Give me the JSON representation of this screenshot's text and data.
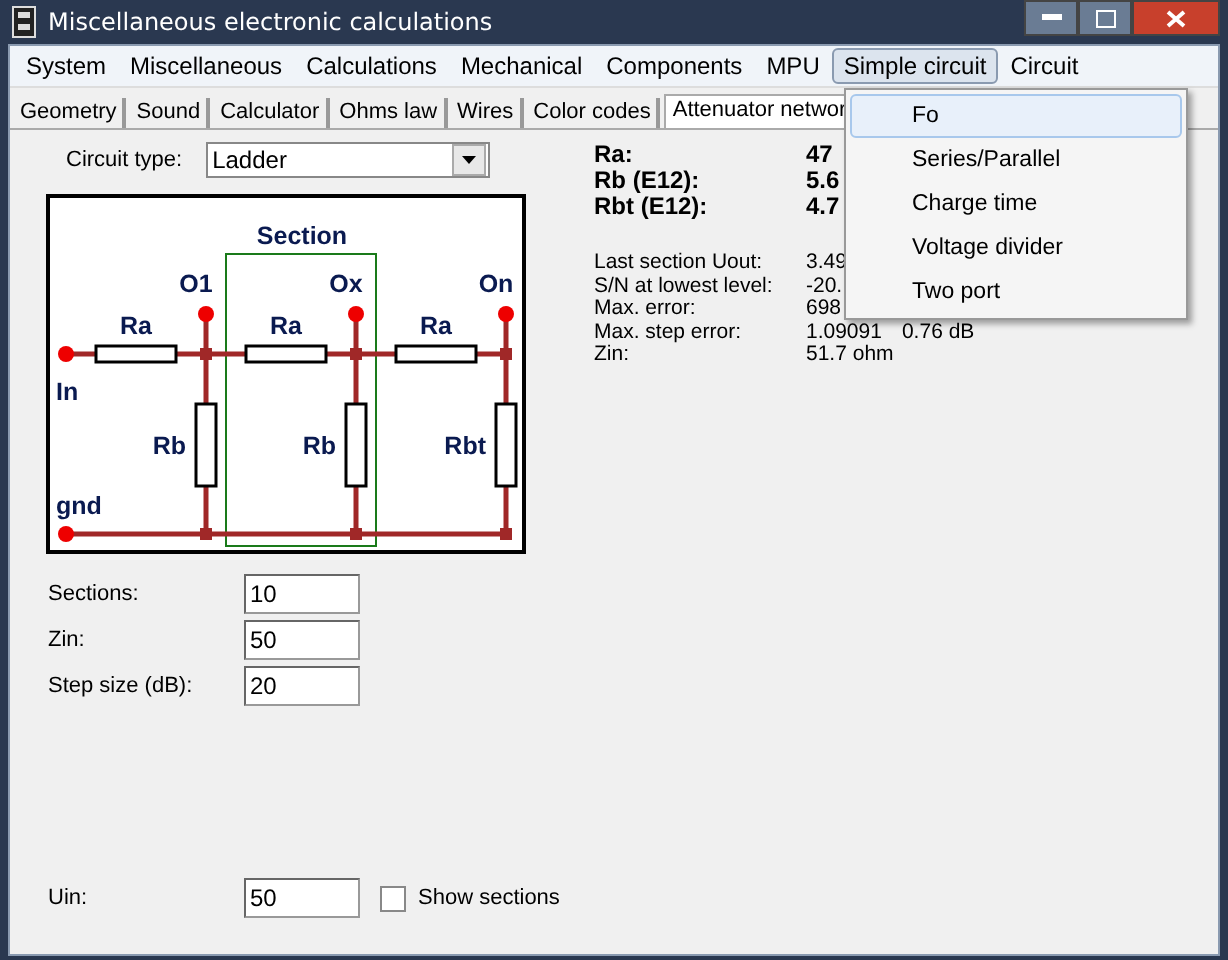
{
  "window": {
    "title": "Miscellaneous electronic calculations"
  },
  "menu_bar": [
    {
      "label": "System",
      "selected": false
    },
    {
      "label": "Miscellaneous",
      "selected": false
    },
    {
      "label": "Calculations",
      "selected": false
    },
    {
      "label": "Mechanical",
      "selected": false
    },
    {
      "label": "Components",
      "selected": false
    },
    {
      "label": "MPU",
      "selected": false
    },
    {
      "label": "Simple circuit",
      "selected": true
    },
    {
      "label": "Circuit",
      "selected": false
    }
  ],
  "tabs": [
    {
      "label": "Geometry",
      "selected": false
    },
    {
      "label": "Sound",
      "selected": false
    },
    {
      "label": "Calculator",
      "selected": false
    },
    {
      "label": "Ohms law",
      "selected": false
    },
    {
      "label": "Wires",
      "selected": false
    },
    {
      "label": "Color codes",
      "selected": false
    },
    {
      "label": "Attenuator networ",
      "selected": true
    }
  ],
  "circuit_type": {
    "label": "Circuit type:",
    "value": "Ladder"
  },
  "diagram": {
    "section_label": "Section",
    "input_label": "In",
    "ground_label": "gnd",
    "nodes": [
      "O1",
      "Ox",
      "On"
    ],
    "series_resistors": [
      "Ra",
      "Ra",
      "Ra"
    ],
    "shunt_resistors": [
      "Rb",
      "Rb",
      "Rbt"
    ]
  },
  "results_main": [
    {
      "label": "Ra:",
      "value": "47"
    },
    {
      "label": "Rb (E12):",
      "value": "5.6"
    },
    {
      "label": "Rbt (E12):",
      "value": "4.7"
    }
  ],
  "results_detail": [
    {
      "label": "Last section Uout:",
      "values": [
        "3.49"
      ]
    },
    {
      "label": "S/N at lowest level:",
      "values": [
        "-20."
      ]
    },
    {
      "label": "Max. error:",
      "values": [
        "698"
      ]
    },
    {
      "label": "Max. step error:",
      "values": [
        "1.09091",
        "0.76 dB"
      ]
    },
    {
      "label": "Zin:",
      "values": [
        "51.7 ohm"
      ]
    }
  ],
  "inputs": [
    {
      "label": "Sections:",
      "value": "10"
    },
    {
      "label": "Zin:",
      "value": "50"
    },
    {
      "label": "Step size (dB):",
      "value": "20"
    }
  ],
  "uin": {
    "label": "Uin:",
    "value": "50"
  },
  "show_sections": {
    "label": "Show sections",
    "checked": false
  },
  "dropdown_menu": [
    {
      "label": "Fo",
      "selected": true
    },
    {
      "label": "Series/Parallel",
      "selected": false
    },
    {
      "label": "Charge time",
      "selected": false
    },
    {
      "label": "Voltage divider",
      "selected": false
    },
    {
      "label": "Two port",
      "selected": false
    }
  ]
}
